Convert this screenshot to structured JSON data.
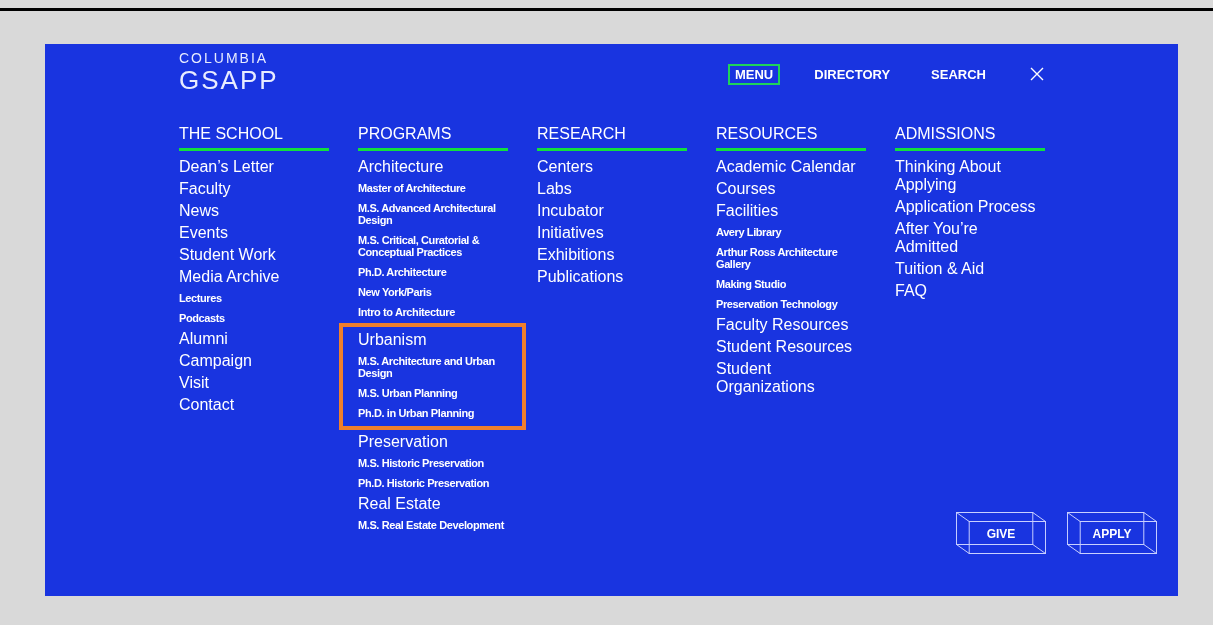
{
  "logo": {
    "line_1": "COLUMBIA",
    "line_2": "GSAPP"
  },
  "nav": [
    {
      "label": "MENU",
      "selected": true
    },
    {
      "label": "DIRECTORY",
      "selected": false
    },
    {
      "label": "SEARCH",
      "selected": false
    }
  ],
  "columns": [
    {
      "heading": "THE SCHOOL",
      "groups": [
        {
          "highlighted": false,
          "items": [
            {
              "kind": "main",
              "label": "Dean’s Letter"
            },
            {
              "kind": "main",
              "label": "Faculty"
            },
            {
              "kind": "main",
              "label": "News"
            },
            {
              "kind": "main",
              "label": "Events"
            },
            {
              "kind": "main",
              "label": "Student Work"
            },
            {
              "kind": "main",
              "label": "Media Archive"
            },
            {
              "kind": "sub",
              "label": "Lectures"
            },
            {
              "kind": "sub",
              "label": "Podcasts"
            },
            {
              "kind": "main",
              "label": "Alumni"
            },
            {
              "kind": "main",
              "label": "Campaign"
            },
            {
              "kind": "main",
              "label": "Visit"
            },
            {
              "kind": "main",
              "label": "Contact"
            }
          ]
        }
      ]
    },
    {
      "heading": "PROGRAMS",
      "groups": [
        {
          "highlighted": false,
          "items": [
            {
              "kind": "main",
              "label": "Architecture"
            },
            {
              "kind": "sub",
              "label": "Master of Architecture"
            },
            {
              "kind": "sub",
              "label": "M.S. Advanced Architectural Design"
            },
            {
              "kind": "sub",
              "label": "M.S. Critical, Curatorial & Conceptual Practices"
            },
            {
              "kind": "sub",
              "label": "Ph.D. Architecture"
            },
            {
              "kind": "sub",
              "label": "New York/Paris"
            },
            {
              "kind": "sub",
              "label": "Intro to Architecture"
            }
          ]
        },
        {
          "highlighted": true,
          "items": [
            {
              "kind": "main",
              "label": "Urbanism"
            },
            {
              "kind": "sub",
              "label": "M.S. Architecture and Urban Design"
            },
            {
              "kind": "sub",
              "label": "M.S. Urban Planning"
            },
            {
              "kind": "sub",
              "label": "Ph.D. in Urban Planning"
            }
          ]
        },
        {
          "highlighted": false,
          "items": [
            {
              "kind": "main",
              "label": "Preservation"
            },
            {
              "kind": "sub",
              "label": "M.S. Historic Preservation"
            },
            {
              "kind": "sub",
              "label": "Ph.D. Historic Preservation"
            },
            {
              "kind": "main",
              "label": "Real Estate"
            },
            {
              "kind": "sub",
              "label": "M.S. Real Estate Development"
            }
          ]
        }
      ]
    },
    {
      "heading": "RESEARCH",
      "groups": [
        {
          "highlighted": false,
          "items": [
            {
              "kind": "main",
              "label": "Centers"
            },
            {
              "kind": "main",
              "label": "Labs"
            },
            {
              "kind": "main",
              "label": "Incubator"
            },
            {
              "kind": "main",
              "label": "Initiatives"
            },
            {
              "kind": "main",
              "label": "Exhibitions"
            },
            {
              "kind": "main",
              "label": "Publications"
            }
          ]
        }
      ]
    },
    {
      "heading": "RESOURCES",
      "groups": [
        {
          "highlighted": false,
          "items": [
            {
              "kind": "main",
              "label": "Academic Calendar"
            },
            {
              "kind": "main",
              "label": "Courses"
            },
            {
              "kind": "main",
              "label": "Facilities"
            },
            {
              "kind": "sub",
              "label": "Avery Library"
            },
            {
              "kind": "sub",
              "label": "Arthur Ross Architecture Gallery"
            },
            {
              "kind": "sub",
              "label": "Making Studio"
            },
            {
              "kind": "sub",
              "label": "Preservation Technology"
            },
            {
              "kind": "main",
              "label": "Faculty Resources"
            },
            {
              "kind": "main",
              "label": "Student Resources"
            },
            {
              "kind": "main",
              "label": "Student Organizations"
            }
          ]
        }
      ]
    },
    {
      "heading": "ADMISSIONS",
      "groups": [
        {
          "highlighted": false,
          "items": [
            {
              "kind": "main",
              "label": "Thinking About Applying"
            },
            {
              "kind": "main",
              "label": "Application Process"
            },
            {
              "kind": "main",
              "label": "After You’re Admitted"
            },
            {
              "kind": "main",
              "label": "Tuition & Aid"
            },
            {
              "kind": "main",
              "label": "FAQ"
            }
          ]
        }
      ]
    }
  ],
  "actions": [
    "GIVE",
    "APPLY"
  ]
}
